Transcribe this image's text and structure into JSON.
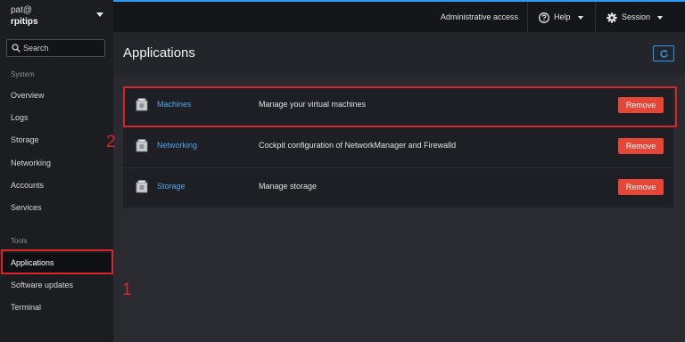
{
  "host": {
    "user": "pat@",
    "name": "rpitips"
  },
  "search": {
    "label": "Search"
  },
  "sidebar": {
    "system_label": "System",
    "system_items": [
      "Overview",
      "Logs",
      "Storage",
      "Networking",
      "Accounts",
      "Services"
    ],
    "tools_label": "Tools",
    "tools_items": [
      "Applications",
      "Software updates",
      "Terminal"
    ],
    "active": "Applications"
  },
  "topbar": {
    "admin_access": "Administrative access",
    "help": "Help",
    "session": "Session"
  },
  "page": {
    "title": "Applications"
  },
  "applications": [
    {
      "name": "Machines",
      "description": "Manage your virtual machines",
      "action": "Remove"
    },
    {
      "name": "Networking",
      "description": "Cockpit configuration of NetworkManager and Firewalld",
      "action": "Remove"
    },
    {
      "name": "Storage",
      "description": "Manage storage",
      "action": "Remove"
    }
  ],
  "annotations": {
    "first": "1",
    "second": "2"
  },
  "colors": {
    "accent": "#2b9af3",
    "danger": "#e54635",
    "annotation": "#d6262c"
  }
}
